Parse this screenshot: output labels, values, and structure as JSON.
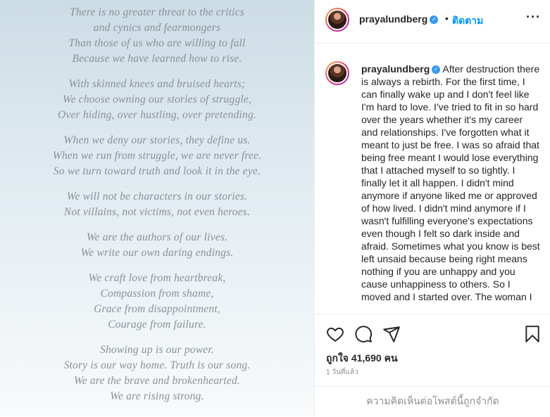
{
  "poem": {
    "stanzas": [
      [
        "There is no greater threat to the critics",
        "and cynics and fearmongers",
        "Than those of us who are willing to fall",
        "Because we have learned how to rise."
      ],
      [
        "With skinned knees and bruised hearts;",
        "We choose owning our stories of struggle,",
        "Over hiding, over hustling, over pretending."
      ],
      [
        "When we deny our stories, they define us.",
        "When we run from struggle, we are never free.",
        "So we turn toward truth and look it in the eye."
      ],
      [
        "We will not be characters in our stories.",
        "Not villains, not victims, not even heroes."
      ],
      [
        "We are the authors of our lives.",
        "We write our own daring endings."
      ],
      [
        "We craft love from heartbreak,",
        "Compassion from shame,",
        "Grace from disappointment,",
        "Courage from failure."
      ],
      [
        "Showing up is our power.",
        "Story is our way home. Truth is our song.",
        "We are the brave and brokenhearted.",
        "We are rising strong."
      ]
    ]
  },
  "header": {
    "username": "prayalundberg",
    "verified_glyph": "✓",
    "dot": "•",
    "follow_label": "ติดตาม",
    "more_label": "···",
    "more_icon": "more-options-icon"
  },
  "caption": {
    "username": "prayalundberg",
    "text": "After destruction there is always a rebirth. For the first time, I can finally wake up and I don't feel like I'm hard to love. I've tried to fit in so hard over the years whether it's my career and relationships. I've forgotten what it meant to just be free. I was so afraid that being free meant I would lose everything that I attached myself to so tightly. I finally let it all happen. I didn't mind anymore if anyone liked me or approved of how lived. I didn't mind anymore if I wasn't fulfilling everyone's expectations even though I felt so dark inside and afraid. Sometimes what you know is best left unsaid because being right means nothing if you are unhappy and you cause unhappiness to others. So I moved and I started over. The woman I"
  },
  "actions": {
    "icons": [
      "heart-icon",
      "comment-icon",
      "share-icon",
      "bookmark-icon"
    ],
    "likes_text": "ถูกใจ 41,690 คน",
    "time_text": "1 วันที่แล้ว",
    "comments_disabled_text": "ความคิดเห็นต่อโพสต์นี้ถูกจำกัด"
  },
  "colors": {
    "accent": "#0095f6",
    "verified": "#3897f0",
    "text": "#262626",
    "muted": "#8e8e8e",
    "poem_text": "#8a9097"
  }
}
